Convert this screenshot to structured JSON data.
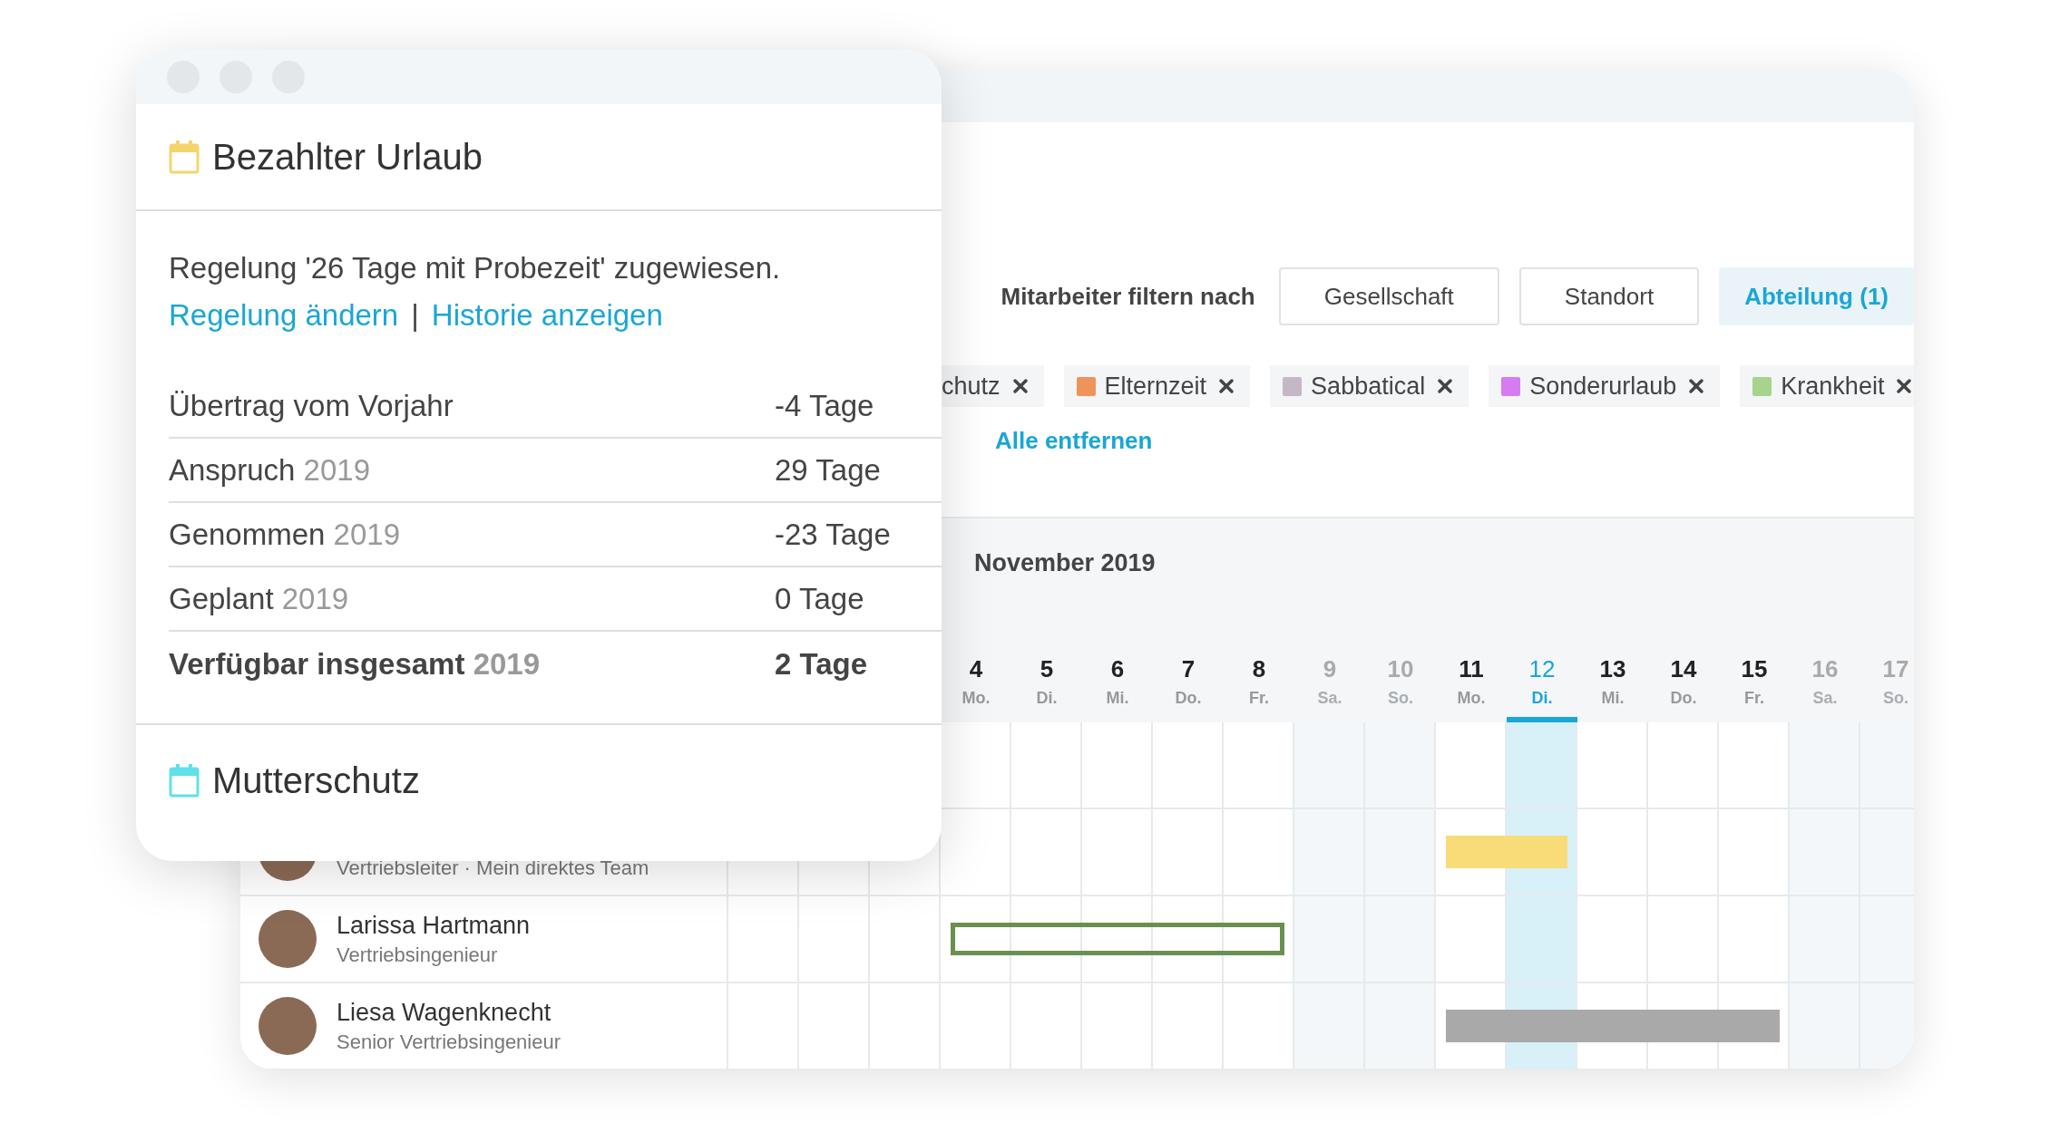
{
  "planner": {
    "filter": {
      "label": "Mitarbeiter filtern nach",
      "buttons": [
        {
          "label": "Gesellschaft",
          "selected": false
        },
        {
          "label": "Standort",
          "selected": false
        },
        {
          "label": "Abteilung (1)",
          "selected": true
        }
      ]
    },
    "chips": [
      {
        "label": "chutz"
      },
      {
        "label": "Elternzeit",
        "color": "#f0935a"
      },
      {
        "label": "Sabbatical",
        "color": "#c4b8c6"
      },
      {
        "label": "Sonderurlaub",
        "color": "#d67bf2"
      },
      {
        "label": "Krankheit",
        "color": "#a6d48c"
      }
    ],
    "clear_link": "Alle entfernen",
    "calendar": {
      "month": "November 2019",
      "days": [
        {
          "date": "4",
          "weekday": "Mo.",
          "weekend": false,
          "selected": false
        },
        {
          "date": "5",
          "weekday": "Di.",
          "weekend": false,
          "selected": false
        },
        {
          "date": "6",
          "weekday": "Mi.",
          "weekend": false,
          "selected": false
        },
        {
          "date": "7",
          "weekday": "Do.",
          "weekend": false,
          "selected": false
        },
        {
          "date": "8",
          "weekday": "Fr.",
          "weekend": false,
          "selected": false
        },
        {
          "date": "9",
          "weekday": "Sa.",
          "weekend": true,
          "selected": false
        },
        {
          "date": "10",
          "weekday": "So.",
          "weekend": true,
          "selected": false
        },
        {
          "date": "11",
          "weekday": "Mo.",
          "weekend": false,
          "selected": false
        },
        {
          "date": "12",
          "weekday": "Di.",
          "weekend": false,
          "selected": true
        },
        {
          "date": "13",
          "weekday": "Mi.",
          "weekend": false,
          "selected": false
        },
        {
          "date": "14",
          "weekday": "Do.",
          "weekend": false,
          "selected": false
        },
        {
          "date": "15",
          "weekday": "Fr.",
          "weekend": false,
          "selected": false
        },
        {
          "date": "16",
          "weekday": "Sa.",
          "weekend": true,
          "selected": false
        },
        {
          "date": "17",
          "weekday": "So.",
          "weekend": true,
          "selected": false
        }
      ],
      "rows": [
        {
          "subtitle": "Vertriebsleiter · Mein direktes Team",
          "cells": [
            {
              "kind": "empty"
            },
            {
              "kind": "empty"
            },
            {
              "kind": "empty"
            },
            {
              "kind": "empty"
            },
            {
              "kind": "empty"
            },
            {
              "kind": "empty"
            },
            {
              "kind": "empty"
            },
            {
              "kind": "filled",
              "color": "#f8dc78"
            },
            {
              "kind": "filled",
              "color": "#f8dc78"
            },
            {
              "kind": "empty"
            },
            {
              "kind": "empty"
            },
            {
              "kind": "empty"
            },
            {
              "kind": "empty"
            },
            {
              "kind": "empty"
            }
          ]
        },
        {
          "name": "Larissa Hartmann",
          "subtitle": "Vertriebsingenieur",
          "cells": [
            {
              "kind": "outline",
              "color": "#6a8f4f"
            },
            {
              "kind": "outline",
              "color": "#6a8f4f"
            },
            {
              "kind": "outline",
              "color": "#6a8f4f"
            },
            {
              "kind": "outline",
              "color": "#6a8f4f"
            },
            {
              "kind": "outline",
              "color": "#6a8f4f"
            },
            {
              "kind": "empty"
            },
            {
              "kind": "empty"
            },
            {
              "kind": "empty"
            },
            {
              "kind": "empty"
            },
            {
              "kind": "empty"
            },
            {
              "kind": "empty"
            },
            {
              "kind": "empty"
            },
            {
              "kind": "empty"
            },
            {
              "kind": "empty"
            }
          ]
        },
        {
          "name": "Liesa Wagenknecht",
          "subtitle": "Senior Vertriebsingenieur",
          "cells": [
            {
              "kind": "empty"
            },
            {
              "kind": "empty"
            },
            {
              "kind": "empty"
            },
            {
              "kind": "empty"
            },
            {
              "kind": "empty"
            },
            {
              "kind": "empty"
            },
            {
              "kind": "empty"
            },
            {
              "kind": "filled",
              "color": "#a9a9a9"
            },
            {
              "kind": "filled",
              "color": "#a9a9a9"
            },
            {
              "kind": "filled",
              "color": "#a9a9a9"
            },
            {
              "kind": "filled",
              "color": "#a9a9a9"
            },
            {
              "kind": "filled",
              "color": "#a9a9a9"
            },
            {
              "kind": "empty"
            },
            {
              "kind": "empty"
            }
          ]
        }
      ]
    }
  },
  "card": {
    "sections": [
      {
        "title": "Bezahlter Urlaub",
        "color": "#f5d46e",
        "policy": "Regelung '26 Tage mit Probezeit' zugewiesen.",
        "links": [
          "Regelung ändern",
          "Historie anzeigen"
        ],
        "separator": "|",
        "rows": [
          {
            "kind": "item",
            "label": "Übertrag vom Vorjahr",
            "value": "-4 Tage"
          },
          {
            "kind": "item",
            "label": "Anspruch",
            "year": "2019",
            "value": "29 Tage"
          },
          {
            "kind": "item",
            "label": "Genommen",
            "year": "2019",
            "value": "-23 Tage"
          },
          {
            "kind": "item",
            "label": "Geplant",
            "year": "2019",
            "value": "0 Tage"
          },
          {
            "kind": "total",
            "label": "Verfügbar insgesamt",
            "year": "2019",
            "value": "2 Tage"
          }
        ]
      },
      {
        "title": "Mutterschutz",
        "color": "#5fe0ea"
      }
    ]
  }
}
